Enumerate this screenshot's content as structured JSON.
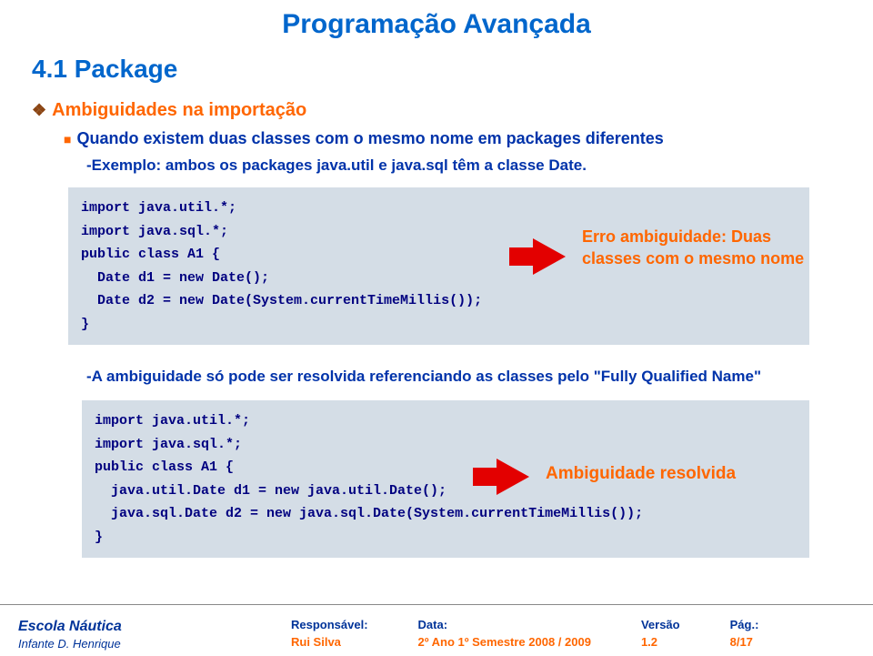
{
  "header": {
    "title": "Programação Avançada"
  },
  "section": {
    "title": "4.1 Package"
  },
  "subtitle": "Ambiguidades na importação",
  "body": "Quando existem duas classes com o mesmo nome em packages diferentes",
  "example": "-Exemplo: ambos os packages java.util e java.sql têm a classe Date.",
  "code1": "import java.util.*;\nimport java.sql.*;\npublic class A1 {\n  Date d1 = new Date();\n  Date d2 = new Date(System.currentTimeMillis());\n}",
  "error": "Erro ambiguidade: Duas classes com o mesmo nome",
  "note": "-A ambiguidade só pode ser resolvida referenciando as classes pelo \"Fully Qualified Name\"",
  "code2": "import java.util.*;\nimport java.sql.*;\npublic class A1 {\n  java.util.Date d1 = new java.util.Date();\n  java.sql.Date d2 = new java.sql.Date(System.currentTimeMillis());\n}",
  "resolved": "Ambiguidade resolvida",
  "footer": {
    "logo1": "Escola Náutica",
    "logo2": "Infante D. Henrique",
    "resp_label": "Responsável:",
    "resp_value": "Rui Silva",
    "data_label": "Data:",
    "data_value": "2º Ano 1º Semestre 2008 / 2009",
    "ver_label": "Versão",
    "ver_value": "1.2",
    "pag_label": "Pág.:",
    "pag_value": "8/17"
  }
}
